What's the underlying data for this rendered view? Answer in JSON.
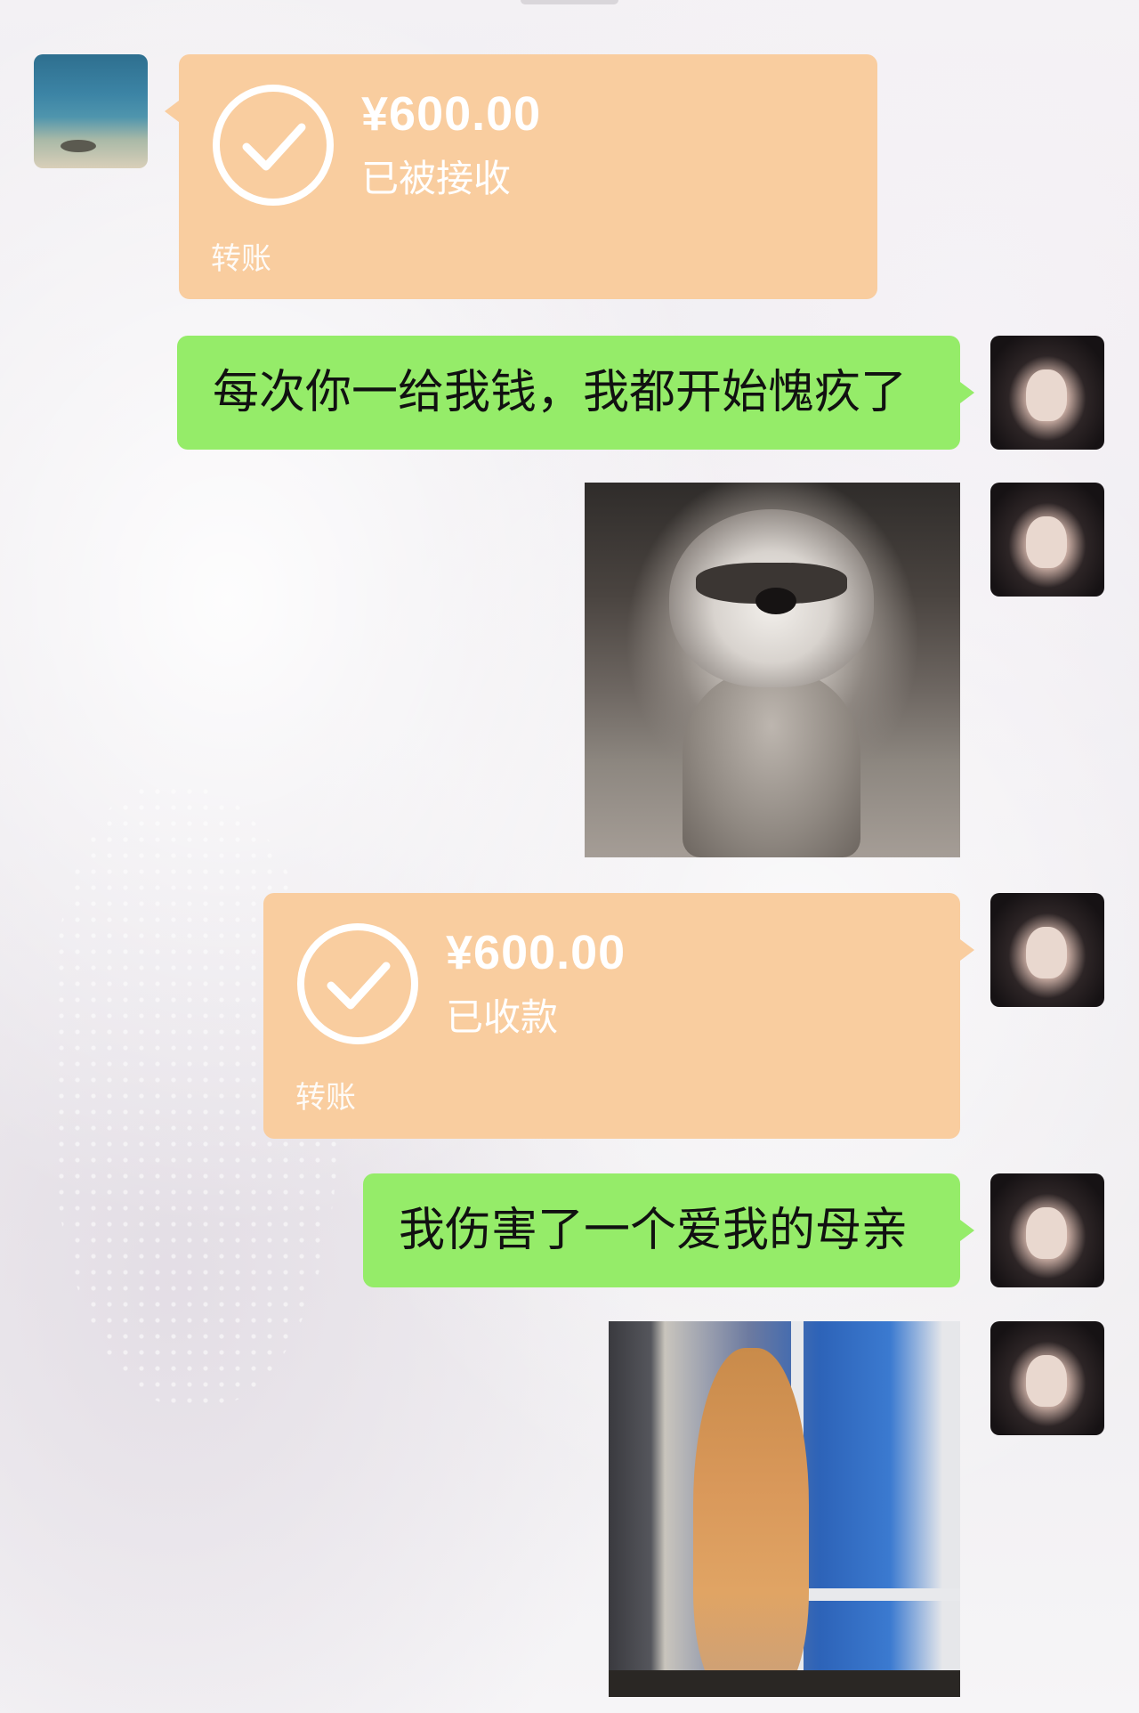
{
  "messages": [
    {
      "type": "transfer",
      "side": "left",
      "avatar_icon": "beach-avatar",
      "amount": "¥600.00",
      "status": "已被接收",
      "label": "转账"
    },
    {
      "type": "text",
      "side": "right",
      "avatar_icon": "girl-avatar",
      "text": "每次你一给我钱，我都开始愧疚了"
    },
    {
      "type": "image",
      "side": "right",
      "avatar_icon": "girl-avatar",
      "image_icon": "smiling-raccoon-image"
    },
    {
      "type": "transfer",
      "side": "right",
      "avatar_icon": "girl-avatar",
      "amount": "¥600.00",
      "status": "已收款",
      "label": "转账"
    },
    {
      "type": "text",
      "side": "right",
      "avatar_icon": "girl-avatar",
      "text": "我伤害了一个爱我的母亲"
    },
    {
      "type": "image",
      "side": "right",
      "avatar_icon": "girl-avatar",
      "image_icon": "cat-at-window-image"
    }
  ],
  "colors": {
    "transfer_bubble": "#f9cd9f",
    "text_bubble": "#95ec69",
    "transfer_text": "#ffffff",
    "message_text": "#111111"
  }
}
